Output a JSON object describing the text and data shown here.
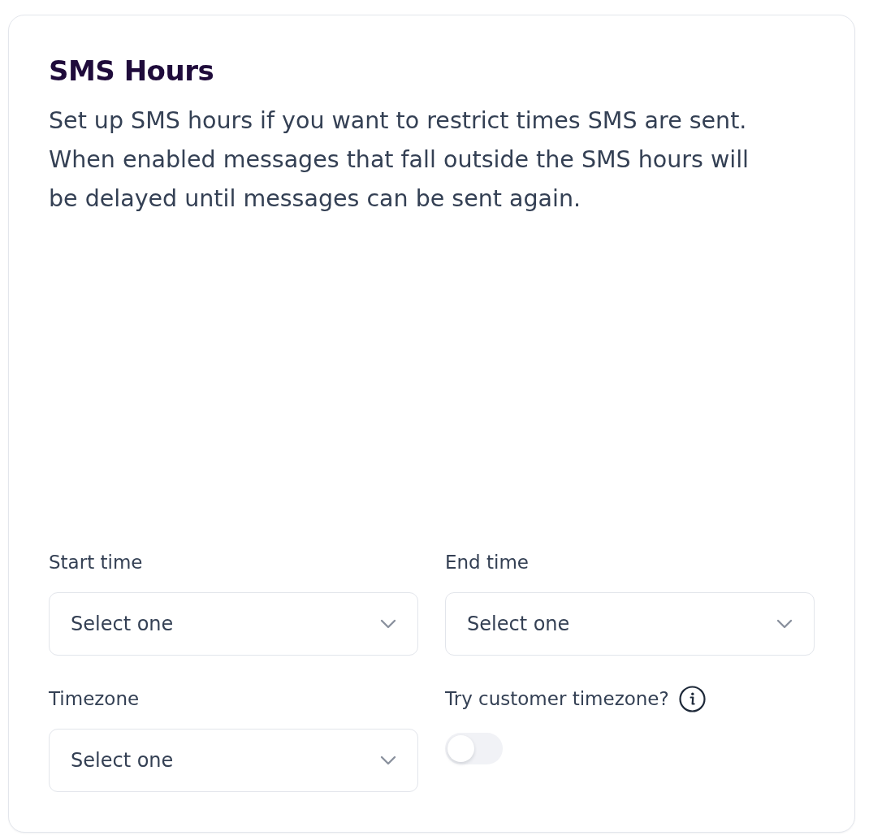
{
  "card": {
    "title": "SMS Hours",
    "description": "Set up SMS hours if you want to restrict times SMS are sent. When enabled messages that fall outside the SMS hours will be delayed until messages can be sent again."
  },
  "fields": [
    {
      "kind": "select",
      "label": "Start time",
      "placeholder": "Select one"
    },
    {
      "kind": "select",
      "label": "End time",
      "placeholder": "Select one"
    },
    {
      "kind": "select",
      "label": "Timezone",
      "placeholder": "Select one"
    },
    {
      "kind": "toggle",
      "label": "Try customer timezone?",
      "info": true,
      "on": false
    }
  ]
}
